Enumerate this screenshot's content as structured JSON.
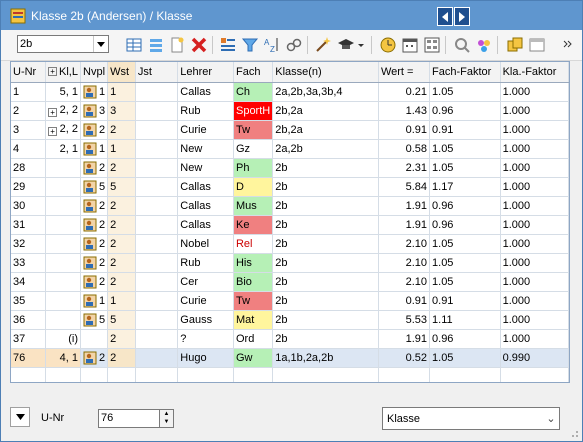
{
  "window": {
    "title": "Klasse 2b (Andersen) / Klasse"
  },
  "toolbar": {
    "class_select_value": "2b",
    "icons": [
      "new-row-icon",
      "list-icon",
      "new-document-icon",
      "delete-icon",
      "teacher-list-icon",
      "filter-icon",
      "sort-icon",
      "link-icon",
      "wand-icon",
      "graduation-cap-icon",
      "clock-icon",
      "calendar-icon",
      "grid-settings-icon",
      "zoom-icon",
      "people-icon",
      "copy-icon",
      "window-icon"
    ]
  },
  "grid": {
    "columns": [
      "U-Nr",
      "Kl,L",
      "Nvpl",
      "Wst",
      "Jst",
      "Lehrer",
      "Fach",
      "Klasse(n)",
      "Wert =",
      "Fach-Faktor",
      "Kla.-Faktor"
    ],
    "rows": [
      {
        "unr": "1",
        "kl": "5, 1",
        "plus": false,
        "nvpl": "1",
        "wst": "1",
        "jst": "",
        "lehrer": "Callas",
        "fach": "Ch",
        "fach_color": "#b6f0b6",
        "fach_text_color": "#000000",
        "klassen": "2a,2b,3a,3b,4",
        "wert": "0.21",
        "ff": "1.05",
        "kf": "1.000"
      },
      {
        "unr": "2",
        "kl": "2, 2",
        "plus": true,
        "nvpl": "3",
        "wst": "3",
        "jst": "",
        "lehrer": "Rub",
        "fach": "SportH",
        "fach_color": "#ff0000",
        "fach_text_color": "#ffffff",
        "klassen": "2b,2a",
        "wert": "1.43",
        "ff": "0.96",
        "kf": "1.000"
      },
      {
        "unr": "3",
        "kl": "2, 2",
        "plus": true,
        "nvpl": "2",
        "wst": "2",
        "jst": "",
        "lehrer": "Curie",
        "fach": "Tw",
        "fach_color": "#f08080",
        "fach_text_color": "#000000",
        "klassen": "2b,2a",
        "wert": "0.91",
        "ff": "0.91",
        "kf": "1.000"
      },
      {
        "unr": "4",
        "kl": "2, 1",
        "plus": false,
        "nvpl": "1",
        "wst": "1",
        "jst": "",
        "lehrer": "New",
        "fach": "Gz",
        "fach_color": "#ffffff",
        "fach_text_color": "#000000",
        "klassen": "2a,2b",
        "wert": "0.58",
        "ff": "1.05",
        "kf": "1.000"
      },
      {
        "unr": "28",
        "kl": "",
        "plus": false,
        "nvpl": "2",
        "wst": "2",
        "jst": "",
        "lehrer": "New",
        "fach": "Ph",
        "fach_color": "#b6f0b6",
        "fach_text_color": "#000000",
        "klassen": "2b",
        "wert": "2.31",
        "ff": "1.05",
        "kf": "1.000"
      },
      {
        "unr": "29",
        "kl": "",
        "plus": false,
        "nvpl": "5",
        "wst": "5",
        "jst": "",
        "lehrer": "Callas",
        "fach": "D",
        "fach_color": "#fff59d",
        "fach_text_color": "#000000",
        "klassen": "2b",
        "wert": "5.84",
        "ff": "1.17",
        "kf": "1.000"
      },
      {
        "unr": "30",
        "kl": "",
        "plus": false,
        "nvpl": "2",
        "wst": "2",
        "jst": "",
        "lehrer": "Callas",
        "fach": "Mus",
        "fach_color": "#b6f0b6",
        "fach_text_color": "#000000",
        "klassen": "2b",
        "wert": "1.91",
        "ff": "0.96",
        "kf": "1.000"
      },
      {
        "unr": "31",
        "kl": "",
        "plus": false,
        "nvpl": "2",
        "wst": "2",
        "jst": "",
        "lehrer": "Callas",
        "fach": "Ke",
        "fach_color": "#f08080",
        "fach_text_color": "#000000",
        "klassen": "2b",
        "wert": "1.91",
        "ff": "0.96",
        "kf": "1.000"
      },
      {
        "unr": "32",
        "kl": "",
        "plus": false,
        "nvpl": "2",
        "wst": "2",
        "jst": "",
        "lehrer": "Nobel",
        "fach": "Rel",
        "fach_color": "#ffffff",
        "fach_text_color": "#cc0000",
        "klassen": "2b",
        "wert": "2.10",
        "ff": "1.05",
        "kf": "1.000"
      },
      {
        "unr": "33",
        "kl": "",
        "plus": false,
        "nvpl": "2",
        "wst": "2",
        "jst": "",
        "lehrer": "Rub",
        "fach": "His",
        "fach_color": "#b6f0b6",
        "fach_text_color": "#000000",
        "klassen": "2b",
        "wert": "2.10",
        "ff": "1.05",
        "kf": "1.000"
      },
      {
        "unr": "34",
        "kl": "",
        "plus": false,
        "nvpl": "2",
        "wst": "2",
        "jst": "",
        "lehrer": "Cer",
        "fach": "Bio",
        "fach_color": "#b6f0b6",
        "fach_text_color": "#000000",
        "klassen": "2b",
        "wert": "2.10",
        "ff": "1.05",
        "kf": "1.000"
      },
      {
        "unr": "35",
        "kl": "",
        "plus": false,
        "nvpl": "1",
        "wst": "1",
        "jst": "",
        "lehrer": "Curie",
        "fach": "Tw",
        "fach_color": "#f08080",
        "fach_text_color": "#000000",
        "klassen": "2b",
        "wert": "0.91",
        "ff": "0.91",
        "kf": "1.000"
      },
      {
        "unr": "36",
        "kl": "",
        "plus": false,
        "nvpl": "5",
        "wst": "5",
        "jst": "",
        "lehrer": "Gauss",
        "fach": "Mat",
        "fach_color": "#fff59d",
        "fach_text_color": "#000000",
        "klassen": "2b",
        "wert": "5.53",
        "ff": "1.11",
        "kf": "1.000"
      },
      {
        "unr": "37",
        "kl": "(i)",
        "plus": false,
        "nvpl": "",
        "wst": "2",
        "jst": "",
        "lehrer": "?",
        "fach": "Ord",
        "fach_color": "#ffffff",
        "fach_text_color": "#000000",
        "klassen": "2b",
        "wert": "1.91",
        "ff": "0.96",
        "kf": "1.000"
      },
      {
        "unr": "76",
        "kl": "4, 1",
        "plus": false,
        "nvpl": "2",
        "wst": "2",
        "jst": "",
        "lehrer": "Hugo",
        "fach": "Gw",
        "fach_color": "#b6f0b6",
        "fach_text_color": "#000000",
        "klassen": "1a,1b,2a,2b",
        "wert": "0.52",
        "ff": "1.05",
        "kf": "0.990",
        "selected": true
      }
    ]
  },
  "bottom": {
    "unr_label": "U-Nr",
    "unr_value": "76",
    "view_select_value": "Klasse"
  }
}
